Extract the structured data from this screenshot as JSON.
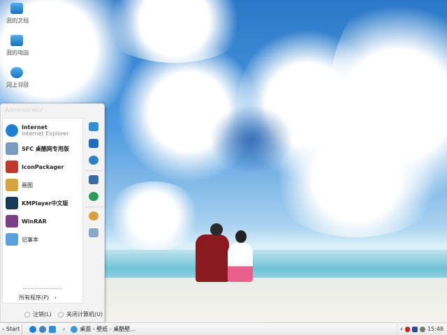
{
  "desktop_icons": [
    {
      "label": "我的文档",
      "icon": "documents-icon"
    },
    {
      "label": "我的电脑",
      "icon": "computer-icon"
    },
    {
      "label": "网上邻居",
      "icon": "network-icon"
    }
  ],
  "start_menu": {
    "user": "Administrator",
    "programs": [
      {
        "title": "Internet",
        "subtitle": "Internet Explorer",
        "icon": "ie-icon",
        "color": "#1d7fd6"
      },
      {
        "title": "SFC 桌酷网专用版",
        "icon": "sfc-icon",
        "color": "#7a9ac0"
      },
      {
        "title": "IconPackager",
        "icon": "iconpackager-icon",
        "color": "#c0392b"
      },
      {
        "title": "画图",
        "icon": "paint-icon",
        "color": "#d9a340"
      },
      {
        "title": "KMPlayer中文版",
        "icon": "kmplayer-icon",
        "color": "#1a3a5a"
      },
      {
        "title": "WinRAR",
        "icon": "winrar-icon",
        "color": "#7b3f8a"
      },
      {
        "title": "记事本",
        "icon": "notepad-icon",
        "color": "#5aa0e0"
      }
    ],
    "all_programs": "所有程序(P)",
    "right_icons": [
      "documents-icon",
      "computer-icon",
      "network-icon",
      "control-panel-icon",
      "internet-icon",
      "search-icon",
      "run-icon"
    ],
    "logoff": "注销(L)",
    "shutdown": "关闭计算机(U)"
  },
  "taskbar": {
    "start": "Start",
    "task": "桌面 - 壁纸 - 桌酷壁...",
    "clock": "15:48"
  }
}
